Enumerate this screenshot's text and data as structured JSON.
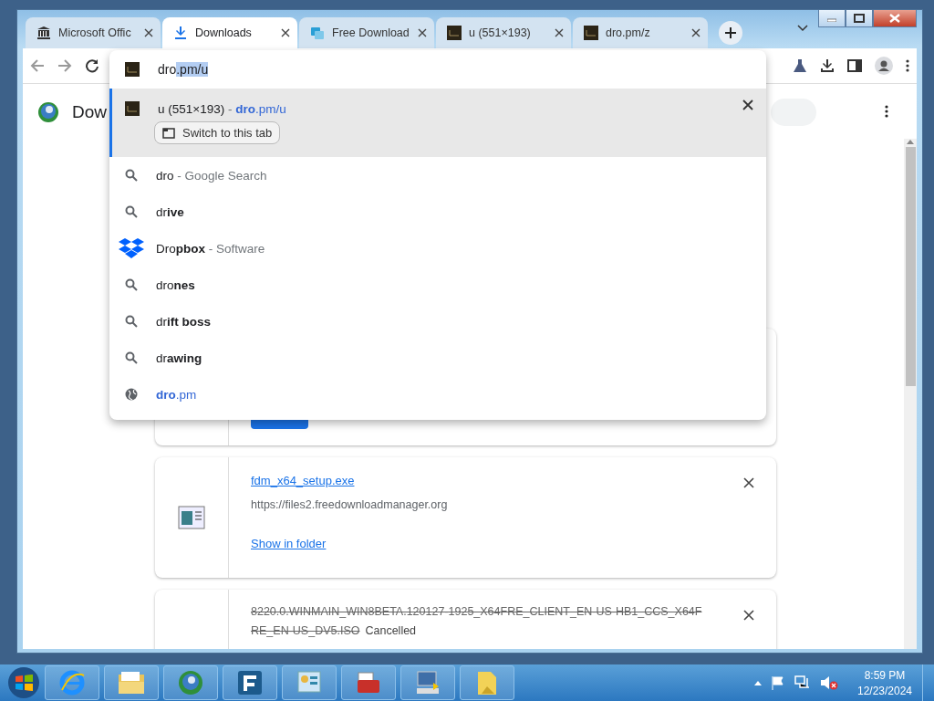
{
  "tabs": [
    {
      "title": "Microsoft Offic",
      "selected": false
    },
    {
      "title": "Downloads",
      "selected": true
    },
    {
      "title": "Free Download",
      "selected": false
    },
    {
      "title": "u (551×193)",
      "selected": false
    },
    {
      "title": "dro.pm/z",
      "selected": false
    }
  ],
  "omnibox": {
    "typed": "dro",
    "completion": ".pm/u"
  },
  "suggestions": [
    {
      "kind": "tab",
      "title": "u (551×193)",
      "separator": "-",
      "url": "**dro**.pm/u",
      "button": "Switch to this tab",
      "selected": true
    },
    {
      "kind": "search",
      "text": "dro",
      "detail": "- Google Search",
      "selected": false
    },
    {
      "kind": "search",
      "text": "dr**ive**",
      "selected": false
    },
    {
      "kind": "app",
      "text": "Dro**pbox**",
      "detail": "- Software",
      "selected": false
    },
    {
      "kind": "search",
      "text": "dro**nes**",
      "selected": false
    },
    {
      "kind": "search",
      "text": "dr**ift boss**",
      "selected": false
    },
    {
      "kind": "search",
      "text": "dr**awing**",
      "selected": false
    },
    {
      "kind": "site",
      "text": "**dro**.pm",
      "selected": false
    }
  ],
  "page": {
    "title": "Dow",
    "downloads": [
      {
        "kind": "covered"
      },
      {
        "kind": "complete",
        "file": "fdm_x64_setup.exe",
        "url": "https://files2.freedownloadmanager.org",
        "action": "Show in folder"
      },
      {
        "kind": "cancelled",
        "file": "8220.0.WINMAIN_WIN8BETA.120127-1925_X64FRE_CLIENT_EN-US-HB1_CCS_X64FRE_EN-US_DV5.ISO",
        "status": "Cancelled"
      }
    ]
  },
  "taskbar": {
    "time": "8:59 PM",
    "date": "12/23/2024"
  }
}
